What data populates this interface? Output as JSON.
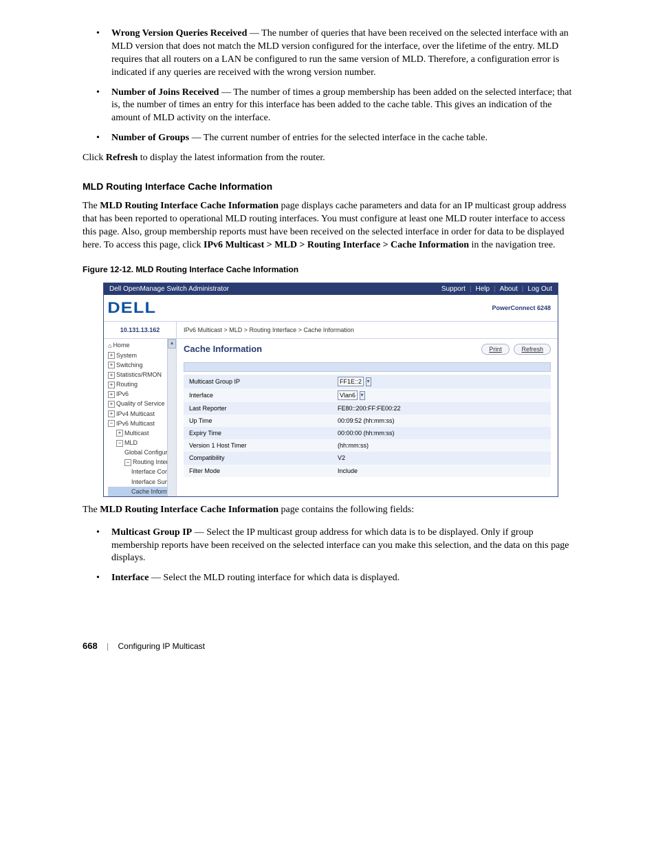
{
  "bullets_top": [
    {
      "term": "Wrong Version Queries Received",
      "desc": " — The number of queries that have been received on the selected interface with an MLD version that does not match the MLD version configured for the interface, over the lifetime of the entry. MLD requires that all routers on a LAN be configured to run the same version of MLD. Therefore, a configuration error is indicated if any queries are received with the wrong version number."
    },
    {
      "term": "Number of Joins Received",
      "desc": " — The number of times a group membership has been added on the selected interface; that is, the number of times an entry for this interface has been added to the cache table. This gives an indication of the amount of MLD activity on the interface."
    },
    {
      "term": "Number of Groups",
      "desc": " — The current number of entries for the selected interface in the cache table."
    }
  ],
  "refresh_para_pre": "Click ",
  "refresh_para_bold": "Refresh",
  "refresh_para_post": " to display the latest information from the router.",
  "section_head": "MLD Routing Interface Cache Information",
  "intro_pre": "The ",
  "intro_bold": "MLD Routing Interface Cache Information",
  "intro_mid": " page displays cache parameters and data for an IP multicast group address that has been reported to operational MLD routing interfaces. You must configure at least one MLD router interface to access this page. Also, group membership reports must have been received on the selected interface in order for data to be displayed here. To access this page, click ",
  "intro_path": "IPv6 Multicast > MLD > Routing Interface > Cache Information",
  "intro_post": " in the navigation tree.",
  "figcap": "Figure 12-12.    MLD Routing Interface Cache Information",
  "shot": {
    "app_title": "Dell OpenManage Switch Administrator",
    "toplinks": [
      "Support",
      "Help",
      "About",
      "Log Out"
    ],
    "model": "PowerConnect 6248",
    "ip": "10.131.13.162",
    "nav": [
      {
        "cls": "lvl1",
        "icon": "home",
        "label": "Home"
      },
      {
        "cls": "lvl1",
        "icon": "plus",
        "label": "System"
      },
      {
        "cls": "lvl1",
        "icon": "plus",
        "label": "Switching"
      },
      {
        "cls": "lvl1",
        "icon": "plus",
        "label": "Statistics/RMON"
      },
      {
        "cls": "lvl1",
        "icon": "plus",
        "label": "Routing"
      },
      {
        "cls": "lvl1",
        "icon": "plus",
        "label": "IPv6"
      },
      {
        "cls": "lvl1",
        "icon": "plus",
        "label": "Quality of Service"
      },
      {
        "cls": "lvl1",
        "icon": "plus",
        "label": "IPv4 Multicast"
      },
      {
        "cls": "lvl1",
        "icon": "minus",
        "label": "IPv6 Multicast"
      },
      {
        "cls": "lvl2",
        "icon": "plus",
        "label": "Multicast"
      },
      {
        "cls": "lvl2",
        "icon": "minus",
        "label": "MLD"
      },
      {
        "cls": "lvl3",
        "icon": "",
        "label": "Global Configurat"
      },
      {
        "cls": "lvl3",
        "icon": "minus",
        "label": "Routing Interface"
      },
      {
        "cls": "lvl4",
        "icon": "",
        "label": "Interface Confi"
      },
      {
        "cls": "lvl4",
        "icon": "",
        "label": "Interface Sum"
      },
      {
        "cls": "lvl4 sel",
        "icon": "",
        "label": "Cache Informa"
      }
    ],
    "crumbs": "IPv6 Multicast > MLD > Routing Interface > Cache Information",
    "page_title": "Cache Information",
    "btn_print": "Print",
    "btn_refresh": "Refresh",
    "rows": [
      {
        "k": "Multicast Group IP",
        "vtype": "sel",
        "v": "FF1E::2"
      },
      {
        "k": "Interface",
        "vtype": "sel",
        "v": "Vlan6"
      },
      {
        "k": "Last Reporter",
        "vtype": "text",
        "v": "FE80::200:FF:FE00:22"
      },
      {
        "k": "Up Time",
        "vtype": "text",
        "v": "00:09:52  (hh:mm:ss)"
      },
      {
        "k": "Expiry Time",
        "vtype": "text",
        "v": "00:00:00  (hh:mm:ss)"
      },
      {
        "k": "Version 1 Host Timer",
        "vtype": "text",
        "v": "             (hh:mm:ss)"
      },
      {
        "k": "Compatibility",
        "vtype": "text",
        "v": "V2"
      },
      {
        "k": "Filter Mode",
        "vtype": "text",
        "v": "Include"
      }
    ]
  },
  "post_shot_pre": "The ",
  "post_shot_bold": "MLD Routing Interface Cache Information",
  "post_shot_post": " page contains the following fields:",
  "bullets_bottom": [
    {
      "term": "Multicast Group IP",
      "desc": " — Select the IP multicast group address for which data is to be displayed. Only if group membership reports have been received on the selected interface can you make this selection, and the data on this page displays."
    },
    {
      "term": "Interface",
      "desc": " — Select the MLD routing interface for which data is displayed."
    }
  ],
  "logo": "DELL",
  "footer": {
    "page": "668",
    "section": "Configuring IP Multicast"
  }
}
